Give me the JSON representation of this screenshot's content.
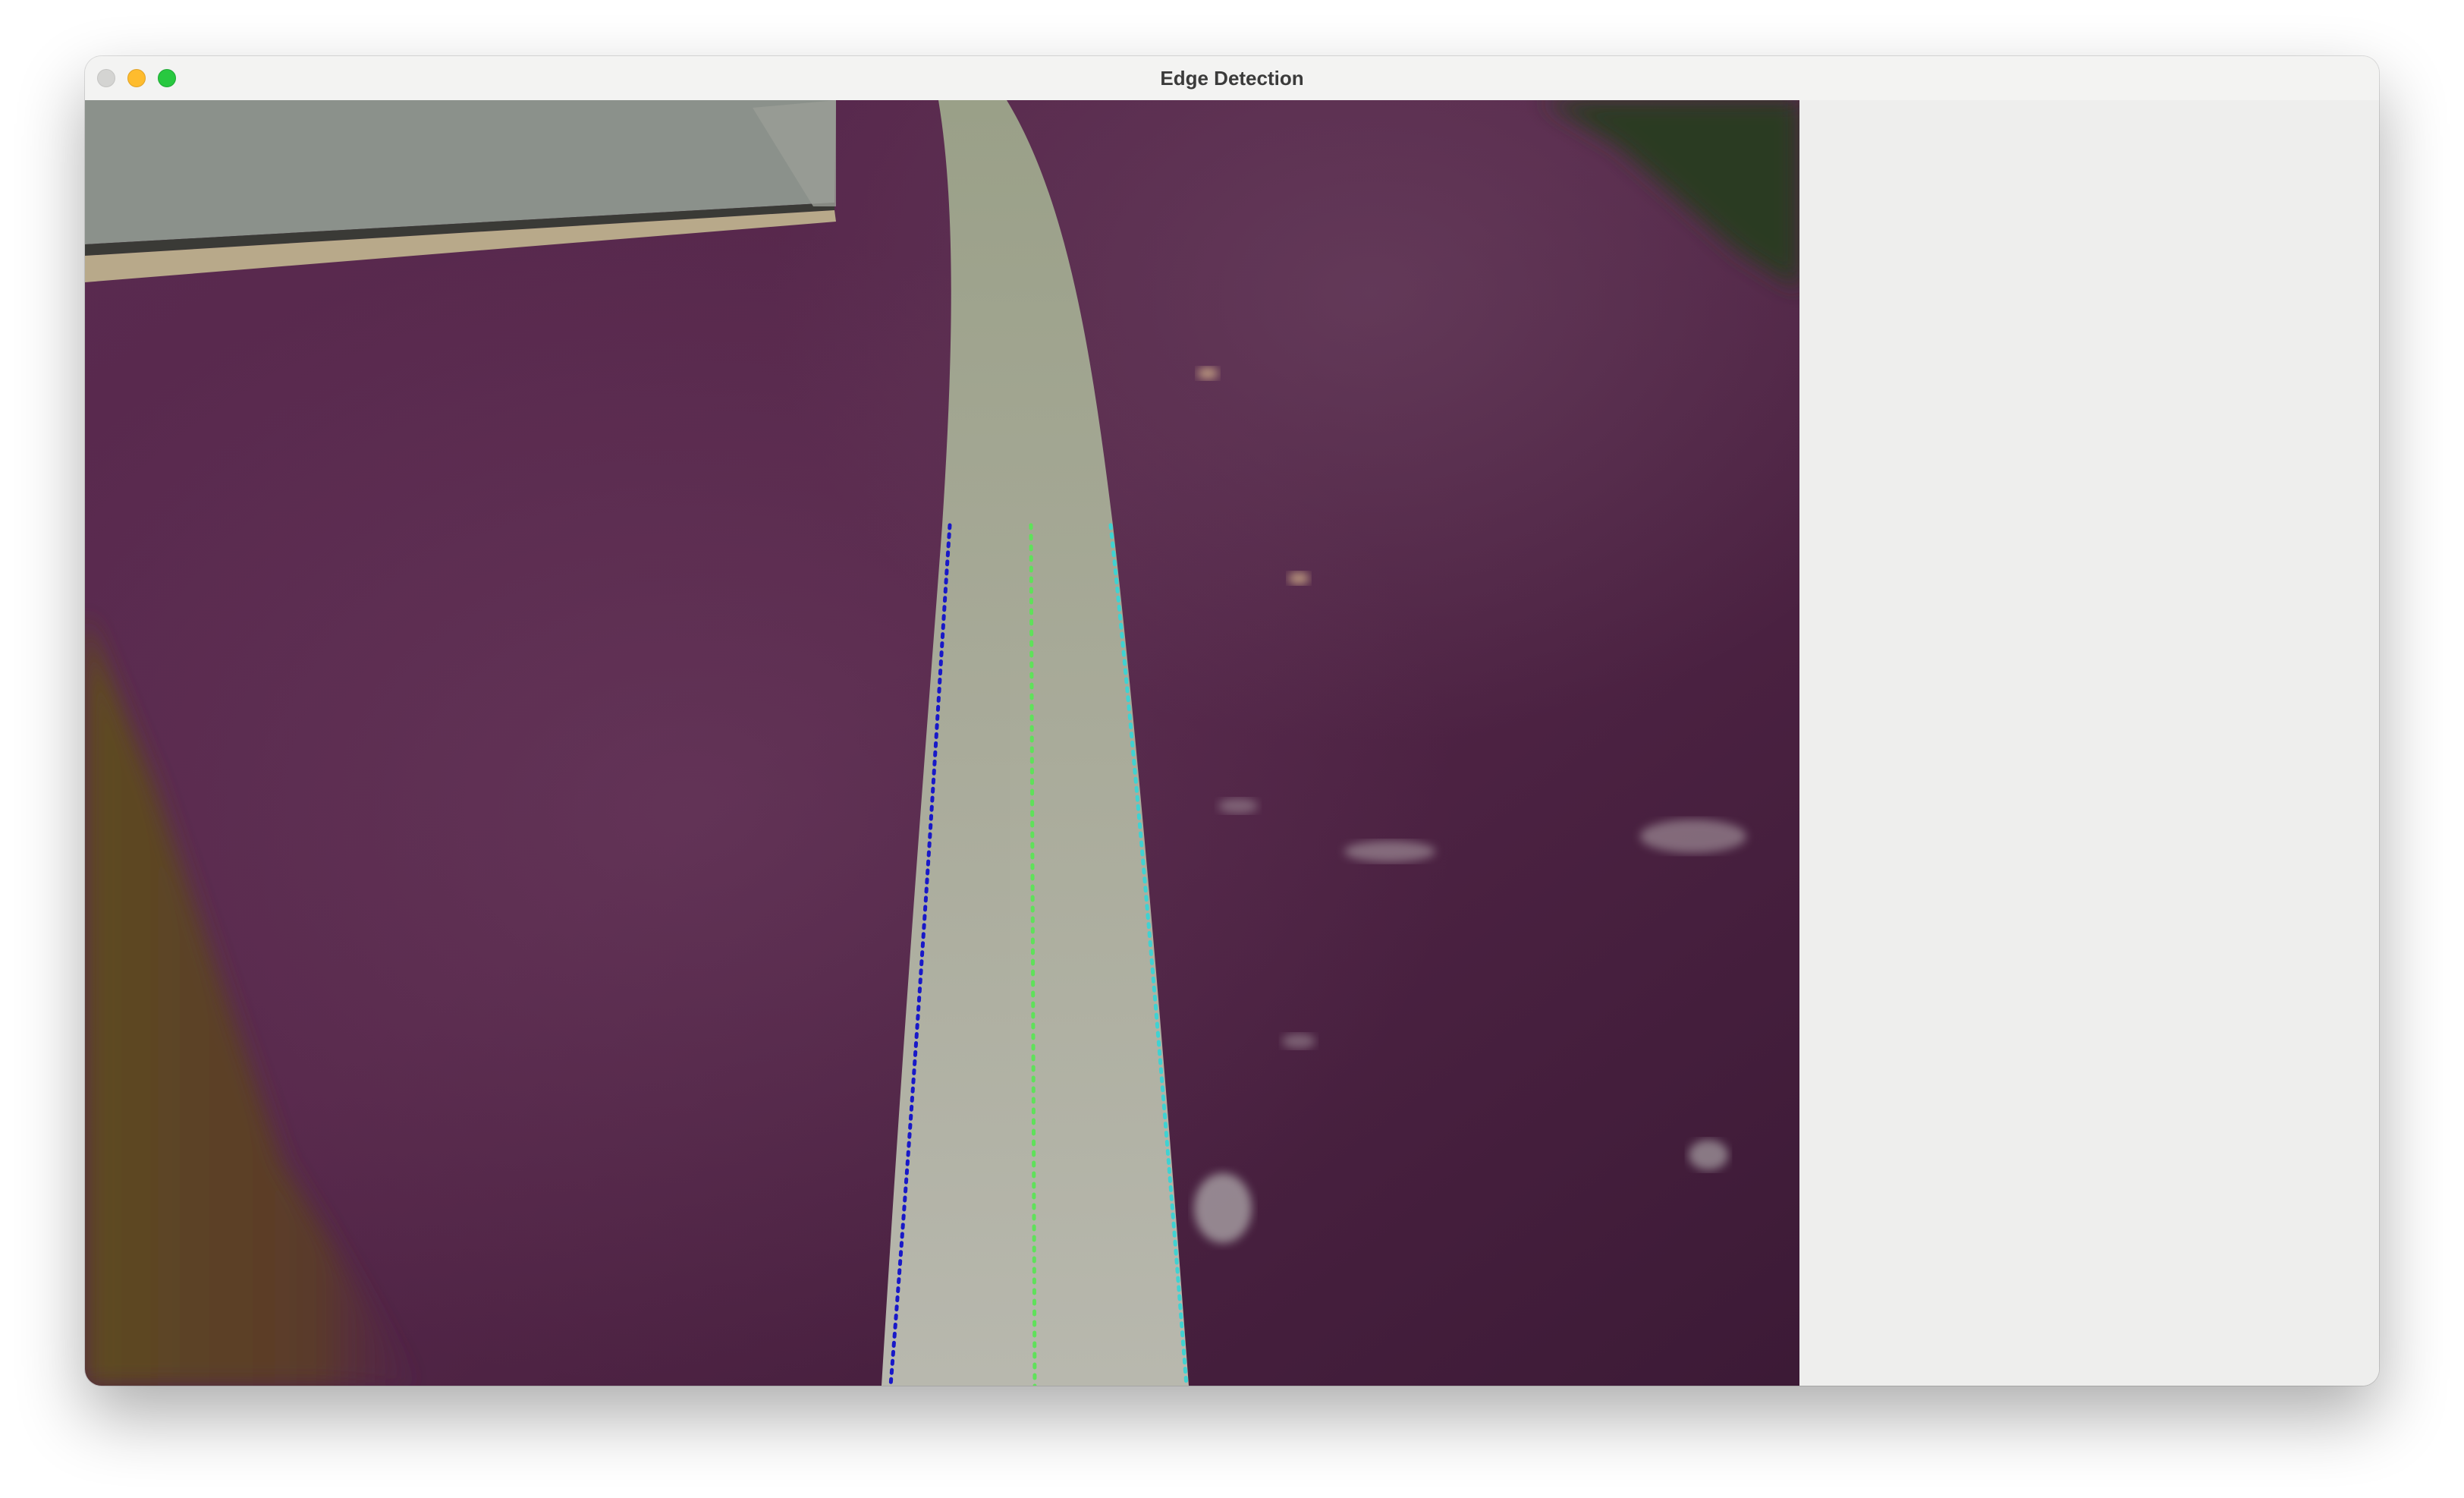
{
  "window": {
    "title": "Edge Detection"
  },
  "titlebar": {
    "buttons": [
      "close-button",
      "minimize-button",
      "zoom-button"
    ]
  },
  "camera_view": {
    "description_icon": "camera-frame",
    "overlay_colors": {
      "left_edge": "#1414c8",
      "center_line": "#5fe15a",
      "right_edge": "#3fd2d2"
    },
    "scene_colors": {
      "floor": "#4f2145",
      "tape": "#a9ab9a",
      "box": "#8a8f8a",
      "corner": "#5a4a22"
    }
  }
}
